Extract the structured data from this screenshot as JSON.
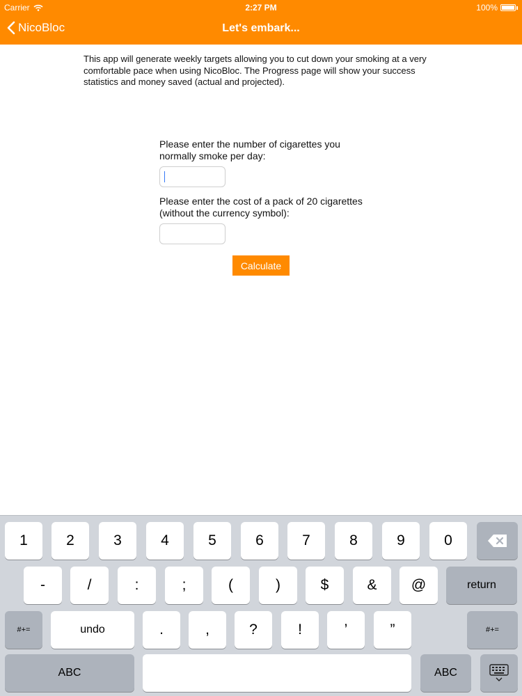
{
  "status_bar": {
    "carrier": "Carrier",
    "time": "2:27 PM",
    "battery": "100%"
  },
  "nav": {
    "back_label": "NicoBloc",
    "title": "Let's embark..."
  },
  "intro_text": "This app will generate weekly targets allowing you to cut down your smoking at a very comfortable pace when using NicoBloc. The Progress page will show your success statistics and money saved (actual and projected).",
  "form": {
    "cigarettes_label": "Please enter the number of cigarettes you normally smoke per day:",
    "cigarettes_value": "",
    "cost_label": "Please enter the cost of a pack of 20 cigarettes (without the currency symbol):",
    "cost_value": "",
    "calculate_label": "Calculate"
  },
  "keyboard": {
    "row1": [
      "1",
      "2",
      "3",
      "4",
      "5",
      "6",
      "7",
      "8",
      "9",
      "0"
    ],
    "row2": [
      "-",
      "/",
      ":",
      ";",
      "(",
      ")",
      "$",
      "&",
      "@"
    ],
    "return_label": "return",
    "shift_label": "#+=",
    "undo_label": "undo",
    "row3": [
      ".",
      ",",
      "?",
      "!",
      "’",
      "”"
    ],
    "abc_label": "ABC"
  },
  "colors": {
    "accent": "#ff8a00",
    "keyboard_bg": "#d1d5db",
    "key_dark": "#adb3bc"
  }
}
